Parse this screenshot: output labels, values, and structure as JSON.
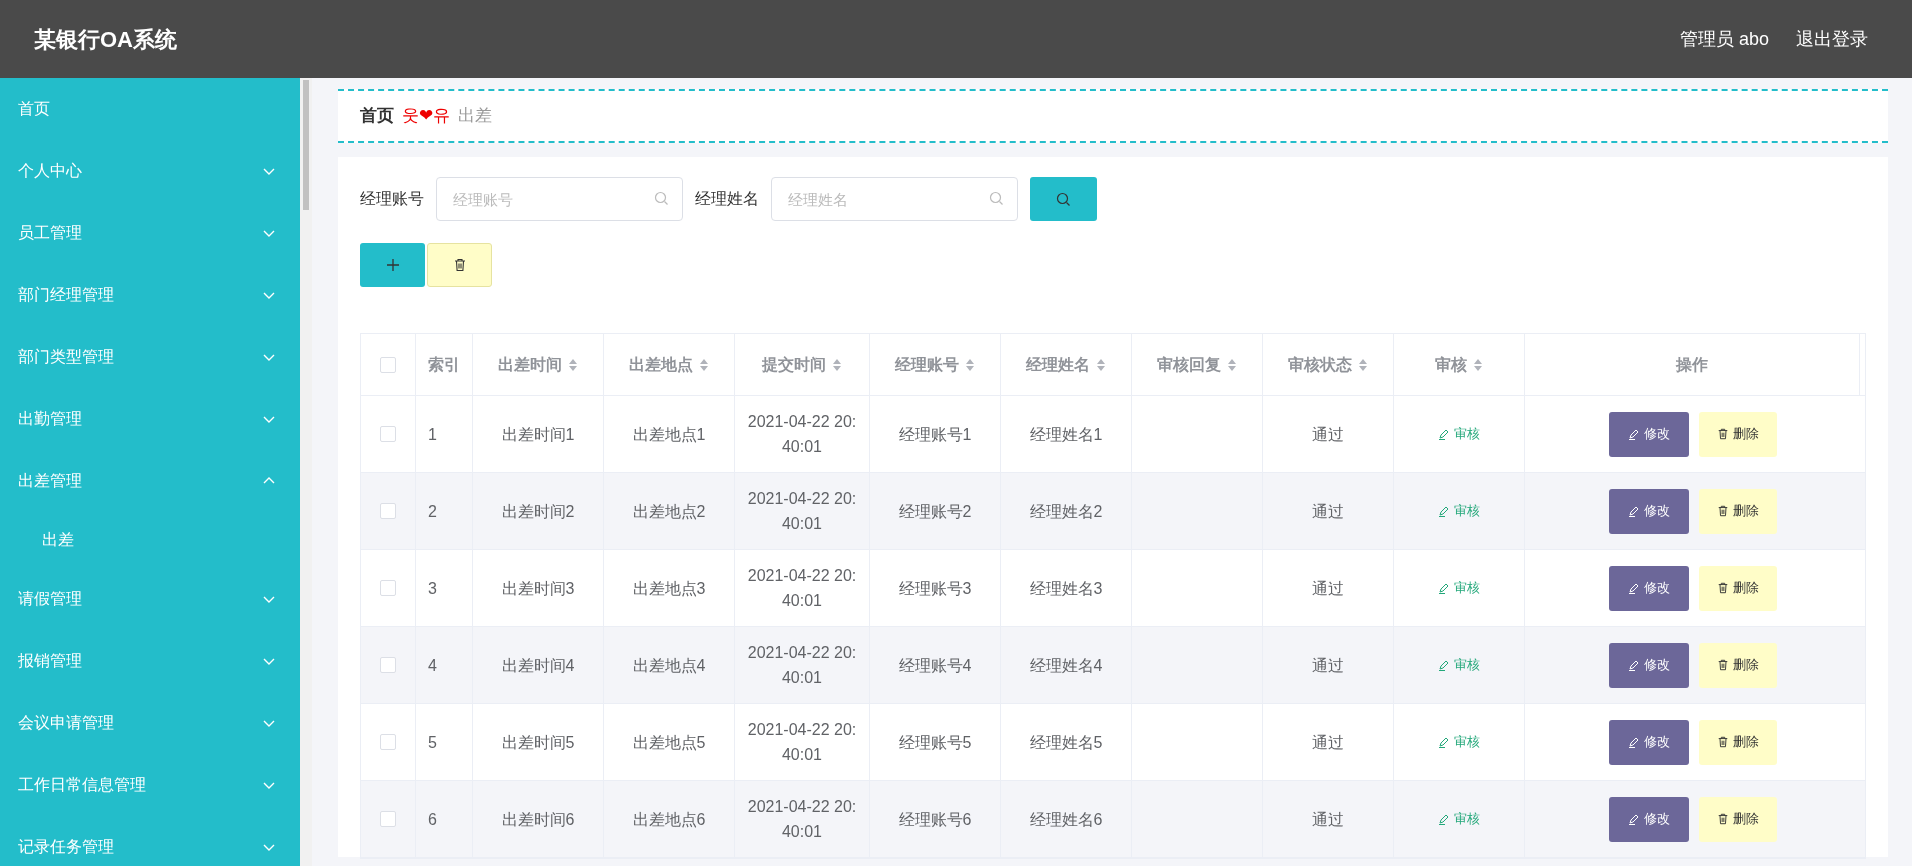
{
  "header": {
    "title": "某银行OA系统",
    "user": "管理员 abo",
    "logout": "退出登录"
  },
  "sidebar": {
    "items": [
      {
        "label": "首页"
      },
      {
        "label": "个人中心",
        "expanded": false
      },
      {
        "label": "员工管理",
        "expanded": false
      },
      {
        "label": "部门经理管理",
        "expanded": false
      },
      {
        "label": "部门类型管理",
        "expanded": false
      },
      {
        "label": "出勤管理",
        "expanded": false
      },
      {
        "label": "出差管理",
        "expanded": true,
        "children": [
          {
            "label": "出差"
          }
        ]
      },
      {
        "label": "请假管理",
        "expanded": false
      },
      {
        "label": "报销管理",
        "expanded": false
      },
      {
        "label": "会议申请管理",
        "expanded": false
      },
      {
        "label": "工作日常信息管理",
        "expanded": false
      },
      {
        "label": "记录任务管理",
        "expanded": false
      }
    ]
  },
  "breadcrumb": {
    "home": "首页",
    "separator": "웃❤유",
    "current": "出差"
  },
  "search": [
    {
      "label": "经理账号",
      "placeholder": "经理账号"
    },
    {
      "label": "经理姓名",
      "placeholder": "经理姓名"
    }
  ],
  "table": {
    "all_checked": false,
    "columns": [
      {
        "label": "索引",
        "sortable": false
      },
      {
        "label": "出差时间",
        "sortable": true
      },
      {
        "label": "出差地点",
        "sortable": true
      },
      {
        "label": "提交时间",
        "sortable": true
      },
      {
        "label": "经理账号",
        "sortable": true
      },
      {
        "label": "经理姓名",
        "sortable": true
      },
      {
        "label": "审核回复",
        "sortable": true
      },
      {
        "label": "审核状态",
        "sortable": true
      },
      {
        "label": "审核",
        "sortable": true
      },
      {
        "label": "操作",
        "sortable": false
      }
    ],
    "rows": [
      {
        "checked": false,
        "cells": [
          "1",
          "出差时间1",
          "出差地点1",
          "2021-04-22 20:40:01",
          "经理账号1",
          "经理姓名1",
          "",
          "通过"
        ],
        "review": "审核",
        "edit": "修改",
        "delete": "删除"
      },
      {
        "checked": false,
        "cells": [
          "2",
          "出差时间2",
          "出差地点2",
          "2021-04-22 20:40:01",
          "经理账号2",
          "经理姓名2",
          "",
          "通过"
        ],
        "review": "审核",
        "edit": "修改",
        "delete": "删除"
      },
      {
        "checked": false,
        "cells": [
          "3",
          "出差时间3",
          "出差地点3",
          "2021-04-22 20:40:01",
          "经理账号3",
          "经理姓名3",
          "",
          "通过"
        ],
        "review": "审核",
        "edit": "修改",
        "delete": "删除"
      },
      {
        "checked": false,
        "cells": [
          "4",
          "出差时间4",
          "出差地点4",
          "2021-04-22 20:40:01",
          "经理账号4",
          "经理姓名4",
          "",
          "通过"
        ],
        "review": "审核",
        "edit": "修改",
        "delete": "删除"
      },
      {
        "checked": false,
        "cells": [
          "5",
          "出差时间5",
          "出差地点5",
          "2021-04-22 20:40:01",
          "经理账号5",
          "经理姓名5",
          "",
          "通过"
        ],
        "review": "审核",
        "edit": "修改",
        "delete": "删除"
      },
      {
        "checked": false,
        "cells": [
          "6",
          "出差时间6",
          "出差地点6",
          "2021-04-22 20:40:01",
          "经理账号6",
          "经理姓名6",
          "",
          "通过"
        ],
        "review": "审核",
        "edit": "修改",
        "delete": "删除"
      }
    ]
  }
}
